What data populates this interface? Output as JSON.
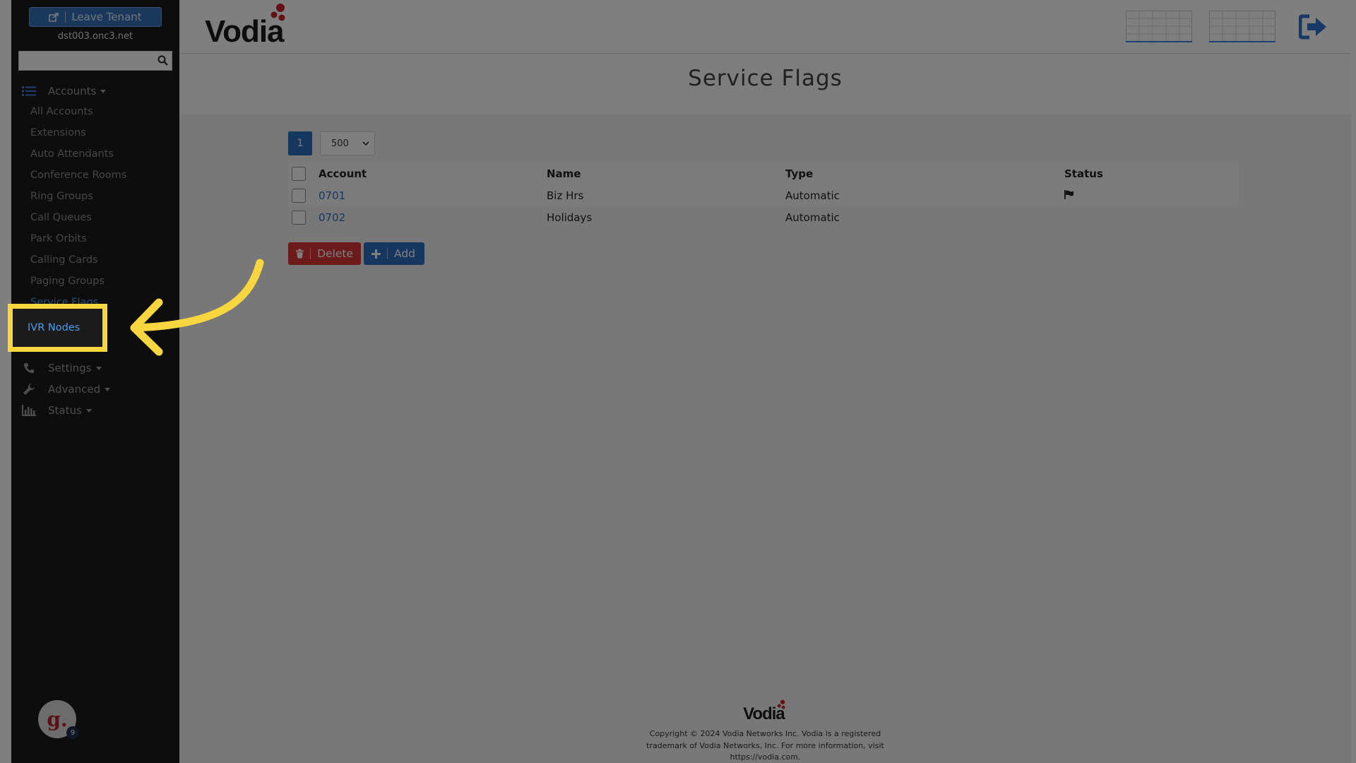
{
  "sidebar": {
    "leave_label": "Leave Tenant",
    "tenant_domain": "dst003.onc3.net",
    "search_placeholder": "",
    "accounts_label": "Accounts",
    "items": [
      {
        "label": "All Accounts"
      },
      {
        "label": "Extensions"
      },
      {
        "label": "Auto Attendants"
      },
      {
        "label": "Conference Rooms"
      },
      {
        "label": "Ring Groups"
      },
      {
        "label": "Call Queues"
      },
      {
        "label": "Park Orbits"
      },
      {
        "label": "Calling Cards"
      },
      {
        "label": "Paging Groups"
      },
      {
        "label": "Service Flags"
      }
    ],
    "groups": [
      {
        "label": "Settings",
        "icon": "phone-icon"
      },
      {
        "label": "Advanced",
        "icon": "wrench-icon"
      },
      {
        "label": "Status",
        "icon": "bar-chart-icon"
      }
    ],
    "avatar_letter": "g.",
    "avatar_badge": "9"
  },
  "header": {
    "logo_text": "Vodia",
    "exit_icon": "logout-icon"
  },
  "page": {
    "title": "Service Flags",
    "current_page": "1",
    "page_size": "500"
  },
  "table": {
    "headers": [
      "Account",
      "Name",
      "Type",
      "Status"
    ],
    "rows": [
      {
        "account": "0701",
        "name": "Biz Hrs",
        "type": "Automatic",
        "status_icon": "flag-icon"
      },
      {
        "account": "0702",
        "name": "Holidays",
        "type": "Automatic",
        "status_icon": ""
      }
    ]
  },
  "actions": {
    "delete_label": "Delete",
    "add_label": "Add"
  },
  "footer": {
    "logo_text": "Vodia",
    "copyright": "Copyright © 2024 Vodia Networks Inc. Vodia is a registered trademark of Vodia Networks, Inc. For more information, visit https://vodia.com."
  },
  "annotation": {
    "highlight_label": "IVR Nodes",
    "color": "#f7d640"
  }
}
